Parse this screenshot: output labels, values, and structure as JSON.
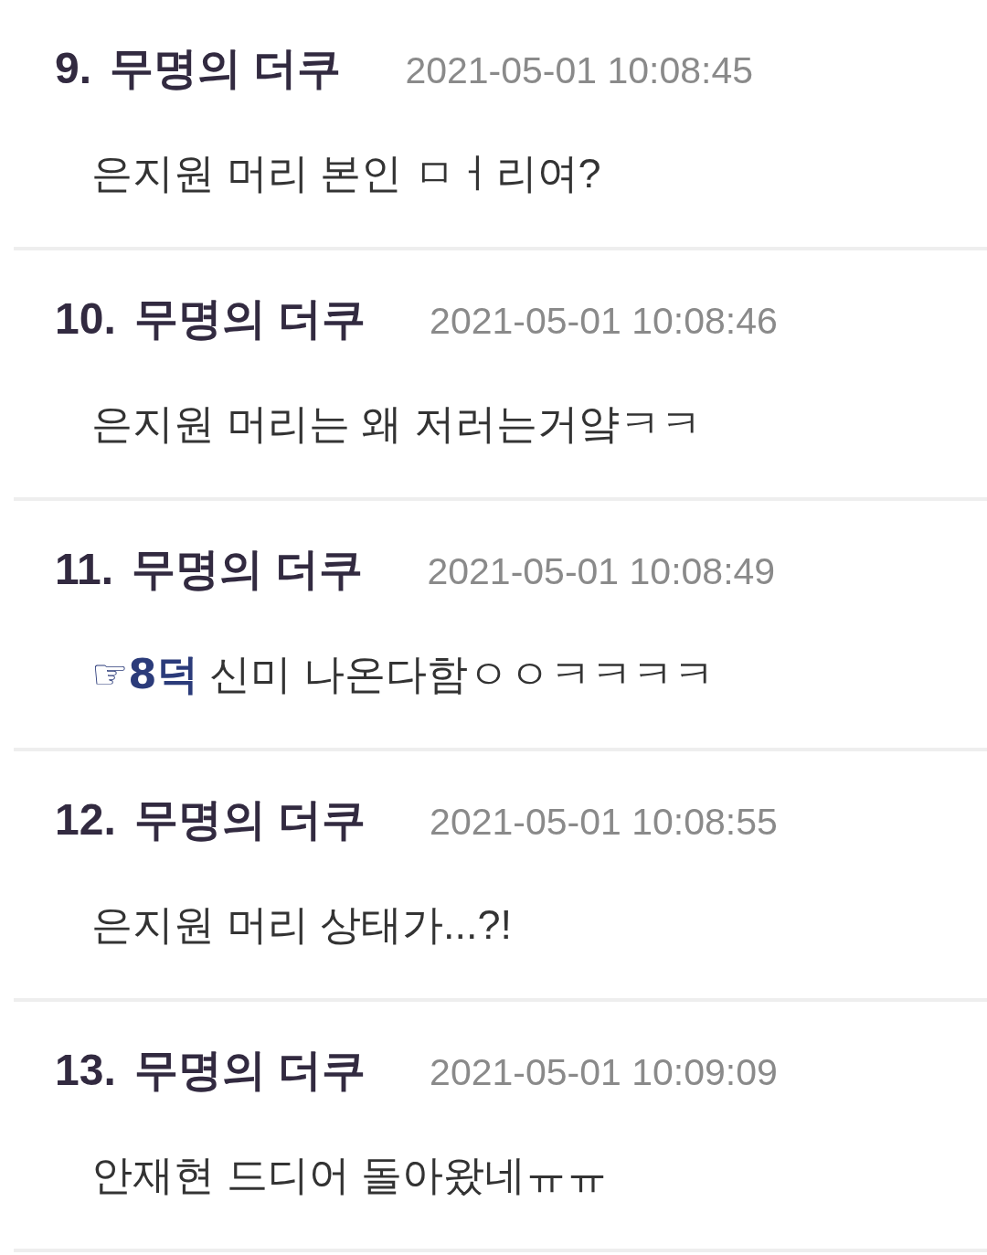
{
  "comments": [
    {
      "number": "9.",
      "author": "무명의 더쿠",
      "date": "2021-05-01 10:08:45",
      "body": [
        {
          "kind": "text",
          "text": "은지원 머리 본인 ㅁㅓ리여?"
        }
      ]
    },
    {
      "number": "10.",
      "author": "무명의 더쿠",
      "date": "2021-05-01 10:08:46",
      "body": [
        {
          "kind": "text",
          "text": "은지원 머리는 왜 저러는거얔ㅋㅋ"
        }
      ]
    },
    {
      "number": "11.",
      "author": "무명의 더쿠",
      "date": "2021-05-01 10:08:49",
      "body": [
        {
          "kind": "link",
          "text": "☞8덕"
        },
        {
          "kind": "text",
          "text": " 신미 나온다함ㅇㅇㅋㅋㅋㅋ"
        }
      ]
    },
    {
      "number": "12.",
      "author": "무명의 더쿠",
      "date": "2021-05-01 10:08:55",
      "body": [
        {
          "kind": "text",
          "text": "은지원 머리 상태가...?!"
        }
      ]
    },
    {
      "number": "13.",
      "author": "무명의 더쿠",
      "date": "2021-05-01 10:09:09",
      "body": [
        {
          "kind": "text",
          "text": "안재현 드디어 돌아왔네ㅠㅠ"
        }
      ]
    }
  ]
}
